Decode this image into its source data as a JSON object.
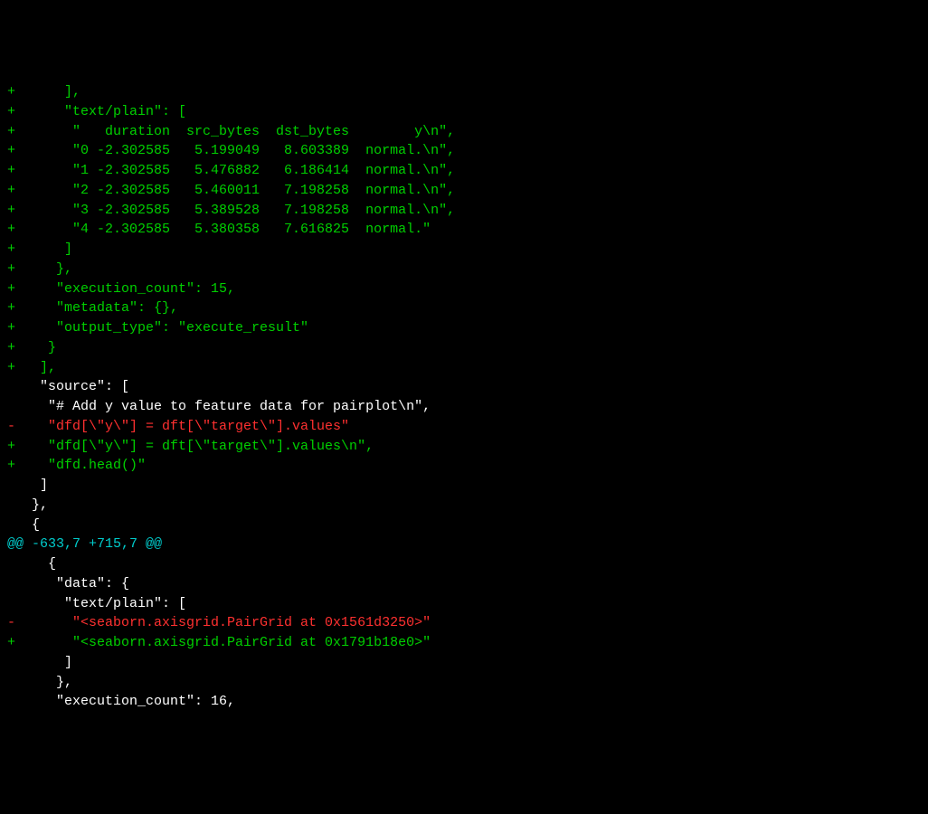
{
  "diff": {
    "lines": [
      {
        "type": "added",
        "text": "+      ],"
      },
      {
        "type": "added",
        "text": "+      \"text/plain\": ["
      },
      {
        "type": "added",
        "text": "+       \"   duration  src_bytes  dst_bytes        y\\n\","
      },
      {
        "type": "added",
        "text": "+       \"0 -2.302585   5.199049   8.603389  normal.\\n\","
      },
      {
        "type": "added",
        "text": "+       \"1 -2.302585   5.476882   6.186414  normal.\\n\","
      },
      {
        "type": "added",
        "text": "+       \"2 -2.302585   5.460011   7.198258  normal.\\n\","
      },
      {
        "type": "added",
        "text": "+       \"3 -2.302585   5.389528   7.198258  normal.\\n\","
      },
      {
        "type": "added",
        "text": "+       \"4 -2.302585   5.380358   7.616825  normal.\""
      },
      {
        "type": "added",
        "text": "+      ]"
      },
      {
        "type": "added",
        "text": "+     },"
      },
      {
        "type": "added",
        "text": "+     \"execution_count\": 15,"
      },
      {
        "type": "added",
        "text": "+     \"metadata\": {},"
      },
      {
        "type": "added",
        "text": "+     \"output_type\": \"execute_result\""
      },
      {
        "type": "added",
        "text": "+    }"
      },
      {
        "type": "added",
        "text": "+   ],"
      },
      {
        "type": "context",
        "text": "    \"source\": ["
      },
      {
        "type": "context",
        "text": "     \"# Add y value to feature data for pairplot\\n\","
      },
      {
        "type": "removed",
        "text": "-    \"dfd[\\\"y\\\"] = dft[\\\"target\\\"].values\""
      },
      {
        "type": "added",
        "text": "+    \"dfd[\\\"y\\\"] = dft[\\\"target\\\"].values\\n\","
      },
      {
        "type": "added",
        "text": "+    \"dfd.head()\""
      },
      {
        "type": "context",
        "text": "    ]"
      },
      {
        "type": "context",
        "text": "   },"
      },
      {
        "type": "context",
        "text": "   {"
      },
      {
        "type": "hunk",
        "text": "@@ -633,7 +715,7 @@"
      },
      {
        "type": "context",
        "text": "     {"
      },
      {
        "type": "context",
        "text": "      \"data\": {"
      },
      {
        "type": "context",
        "text": "       \"text/plain\": ["
      },
      {
        "type": "removed",
        "text": "-       \"<seaborn.axisgrid.PairGrid at 0x1561d3250>\""
      },
      {
        "type": "added",
        "text": "+       \"<seaborn.axisgrid.PairGrid at 0x1791b18e0>\""
      },
      {
        "type": "context",
        "text": "       ]"
      },
      {
        "type": "context",
        "text": "      },"
      },
      {
        "type": "context",
        "text": "      \"execution_count\": 16,"
      }
    ]
  }
}
